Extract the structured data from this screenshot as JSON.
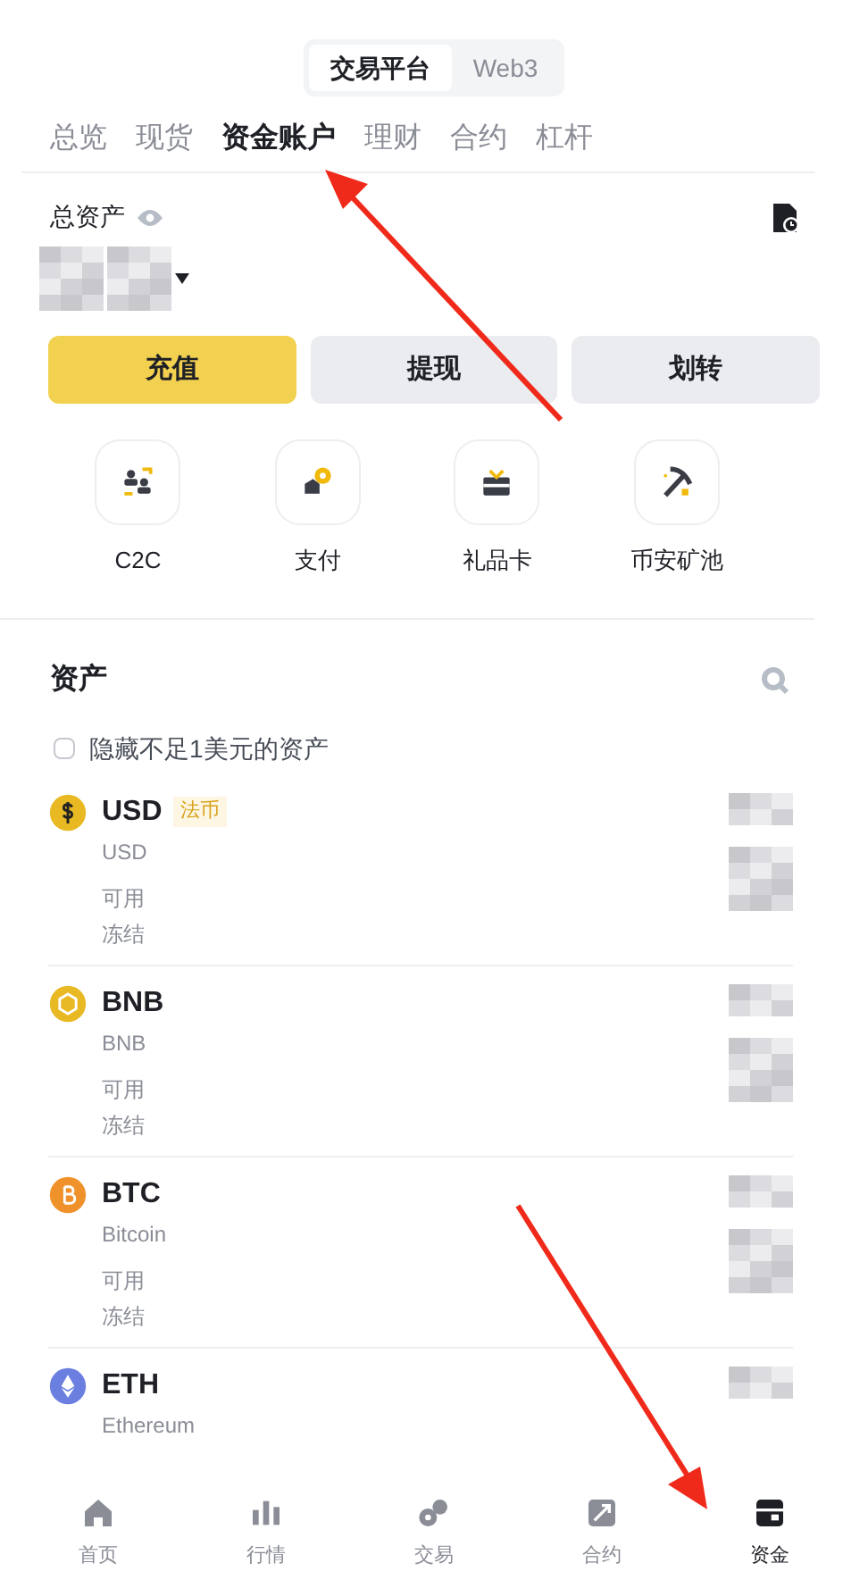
{
  "platform_switch": [
    {
      "label": "交易平台",
      "selected": true
    },
    {
      "label": "Web3",
      "selected": false
    }
  ],
  "account_tabs": [
    {
      "label": "总览",
      "selected": false
    },
    {
      "label": "现货",
      "selected": false
    },
    {
      "label": "资金账户",
      "selected": true
    },
    {
      "label": "理财",
      "selected": false
    },
    {
      "label": "合约",
      "selected": false
    },
    {
      "label": "杠杆",
      "selected": false
    }
  ],
  "total": {
    "label": "总资产"
  },
  "actions": [
    {
      "label": "充值",
      "primary": true
    },
    {
      "label": "提现",
      "primary": false
    },
    {
      "label": "划转",
      "primary": false
    }
  ],
  "shortcuts": [
    {
      "label": "C2C",
      "kind": "people"
    },
    {
      "label": "支付",
      "kind": "pay"
    },
    {
      "label": "礼品卡",
      "kind": "gift"
    },
    {
      "label": "币安矿池",
      "kind": "mine"
    }
  ],
  "assets": {
    "title": "资产",
    "hide_small": {
      "label": "隐藏不足1美元的资产",
      "checked": false
    },
    "items": [
      {
        "symbol": "USD",
        "name": "USD",
        "tag": "法币",
        "color": "#e8b923",
        "kind": "dollar",
        "available": "可用",
        "frozen": "冻结"
      },
      {
        "symbol": "BNB",
        "name": "BNB",
        "color": "#e8b923",
        "kind": "bnb",
        "available": "可用",
        "frozen": "冻结"
      },
      {
        "symbol": "BTC",
        "name": "Bitcoin",
        "color": "#f0922b",
        "kind": "btc",
        "available": "可用",
        "frozen": "冻结"
      },
      {
        "symbol": "ETH",
        "name": "Ethereum",
        "color": "#6b7fe0",
        "kind": "eth"
      }
    ]
  },
  "bottom_nav": [
    {
      "label": "首页",
      "selected": false,
      "kind": "home"
    },
    {
      "label": "行情",
      "selected": false,
      "kind": "chart"
    },
    {
      "label": "交易",
      "selected": false,
      "kind": "trade"
    },
    {
      "label": "合约",
      "selected": false,
      "kind": "futures"
    },
    {
      "label": "资金",
      "selected": true,
      "kind": "wallet"
    }
  ]
}
